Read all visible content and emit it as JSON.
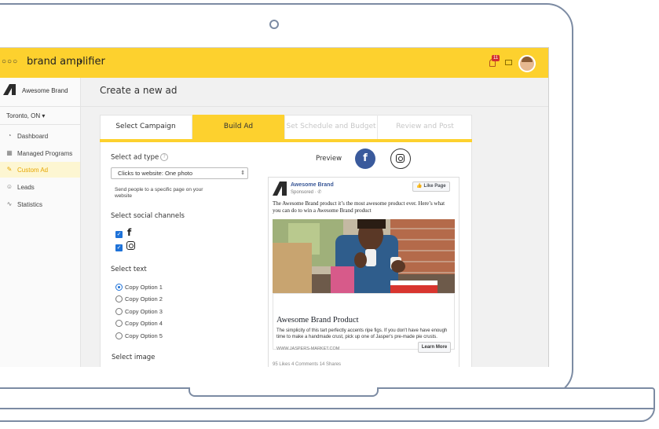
{
  "app": {
    "name": "brand amplifier",
    "logo_dots": "○○○",
    "notification_count": "11",
    "accent_color": "#fdd12e"
  },
  "sidebar": {
    "brand": "Awesome Brand",
    "location": "Toronto, ON ▾",
    "items": [
      {
        "label": "Dashboard",
        "icon": "dashboard-icon",
        "glyph": "◔"
      },
      {
        "label": "Managed Programs",
        "icon": "grid-icon",
        "glyph": "▦"
      },
      {
        "label": "Custom Ad",
        "icon": "pencil-icon",
        "glyph": "✎",
        "active": true
      },
      {
        "label": "Leads",
        "icon": "people-icon",
        "glyph": "☺"
      },
      {
        "label": "Statistics",
        "icon": "chart-icon",
        "glyph": "∿"
      }
    ]
  },
  "page": {
    "title": "Create a new ad"
  },
  "tabs": [
    {
      "label": "Select Campaign",
      "state": "done"
    },
    {
      "label": "Build Ad",
      "state": "active"
    },
    {
      "label": "Set Schedule and Budget",
      "state": "upcoming"
    },
    {
      "label": "Review and Post",
      "state": "upcoming"
    }
  ],
  "form": {
    "ad_type_label": "Select ad type",
    "ad_type_value": "Clicks to website: One photo",
    "ad_type_hint": "Send people to a specific page on your website",
    "channels_label": "Select social channels",
    "channels": [
      {
        "name": "facebook",
        "checked": true,
        "glyph": "f"
      },
      {
        "name": "instagram",
        "checked": true
      }
    ],
    "text_label": "Select text",
    "copy_options": [
      {
        "label": "Copy Option 1",
        "selected": true
      },
      {
        "label": "Copy Option 2",
        "selected": false
      },
      {
        "label": "Copy Option 3",
        "selected": false
      },
      {
        "label": "Copy Option 4",
        "selected": false
      },
      {
        "label": "Copy Option 5",
        "selected": false
      }
    ],
    "image_label": "Select image"
  },
  "preview": {
    "label": "Preview",
    "fb_glyph": "f",
    "post": {
      "brand": "Awesome Brand",
      "sponsored": "Sponsored · ✆",
      "like_button": "👍 Like Page",
      "text": "The Awesome Brand product it’s the most awesome product ever. Here’s what you can do to win a Awesome Brand product",
      "headline": "Awesome Brand Product",
      "description": "The simplicity of this tart perfectly accents ripe figs. If you don't have have enough time to make a handmade crust, pick up one of Jasper's pre-made pie crusts.",
      "url": "WWW.JASPERS-MARKET.COM",
      "cta": "Learn More",
      "stats": "95 Likes   4 Comments   14 Shares"
    }
  }
}
